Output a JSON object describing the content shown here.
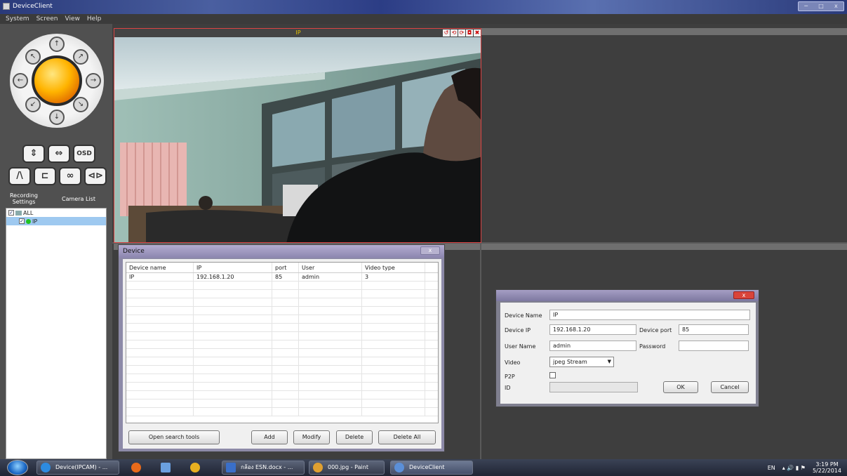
{
  "window": {
    "title": "DeviceClient",
    "controls": [
      "─",
      "□",
      "x"
    ]
  },
  "menu": [
    "System",
    "Screen",
    "View",
    "Help"
  ],
  "ptz": {
    "arrows": [
      "↖",
      "↑",
      "↗",
      "←",
      "→",
      "↙",
      "↓",
      "↘"
    ],
    "controls_row1": [
      "⇕",
      "⇔",
      "OSD"
    ],
    "controls_row2": [
      "/\\",
      "⊏",
      "∞",
      "⊲⊳"
    ],
    "recording_settings_label": "Recording\nSettings",
    "camera_list_label": "Camera List"
  },
  "tree": {
    "root_label": "ALL",
    "root_check": "✓",
    "child_label": "IP",
    "child_check": "✓"
  },
  "video": {
    "title": "IP",
    "icons": [
      "↺",
      "⟲",
      "⟳",
      "◘",
      "✖"
    ]
  },
  "device_dialog": {
    "title": "Device",
    "close": "x",
    "columns": [
      "Device name",
      "IP",
      "port",
      "User",
      "Video type"
    ],
    "rows": [
      {
        "name": "IP",
        "ip": "192.168.1.20",
        "port": "85",
        "user": "admin",
        "video_type": "3"
      }
    ],
    "buttons": {
      "search": "Open search tools",
      "add": "Add",
      "modify": "Modify",
      "delete": "Delete",
      "delete_all": "Delete All"
    }
  },
  "edit_dialog": {
    "close": "x",
    "device_name_label": "Device Name",
    "device_name": "IP",
    "device_ip_label": "Device IP",
    "device_ip": "192.168.1.20",
    "device_port_label": "Device port",
    "device_port": "85",
    "user_name_label": "User Name",
    "user_name": "admin",
    "password_label": "Password",
    "password": "",
    "video_label": "Video",
    "video_value": "jpeg Stream",
    "p2p_label": "P2P",
    "id_label": "ID",
    "id_value": "",
    "ok": "OK",
    "cancel": "Cancel"
  },
  "taskbar": {
    "items": [
      {
        "label": "Device(IPCAM) - ...",
        "icon_color": "#2d8be0"
      },
      {
        "label": "กล้อง ESN.docx - ...",
        "icon_color": "#3a6fc9"
      },
      {
        "label": "000.jpg - Paint",
        "icon_color": "#e0a030"
      },
      {
        "label": "DeviceClient",
        "icon_color": "#5b8fd8"
      }
    ],
    "pinned_colors": [
      "#e86a1a",
      "#6aa0e0",
      "#e8b020"
    ],
    "language": "EN",
    "tray_icons": "▴ 🔊 ▮ ⚑",
    "time": "3:19 PM",
    "date": "5/22/2014"
  },
  "colors": {
    "title_accent": "#2a3a7a",
    "video_border": "#dd4444",
    "video_title": "#e8c400",
    "online_dot": "#22c422"
  }
}
